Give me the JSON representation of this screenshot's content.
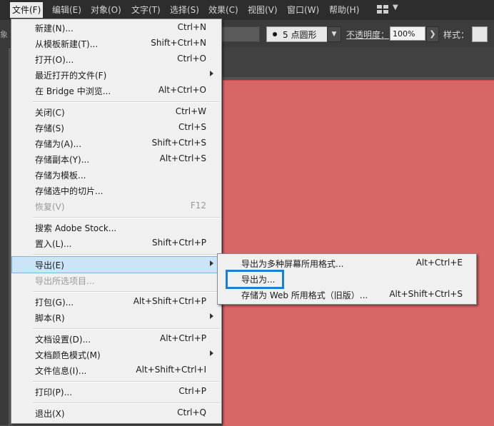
{
  "menubar": {
    "items": [
      "文件(F)",
      "编辑(E)",
      "对象(O)",
      "文字(T)",
      "选择(S)",
      "效果(C)",
      "视图(V)",
      "窗口(W)",
      "帮助(H)"
    ]
  },
  "controlbar": {
    "left_glyph": "象",
    "brush_label": "5 点圆形",
    "opacity_label": "不透明度：",
    "opacity_value": "100%",
    "style_label": "样式："
  },
  "file_menu": {
    "items": [
      {
        "label": "新建(N)...",
        "shortcut": "Ctrl+N"
      },
      {
        "label": "从模板新建(T)...",
        "shortcut": "Shift+Ctrl+N"
      },
      {
        "label": "打开(O)...",
        "shortcut": "Ctrl+O"
      },
      {
        "label": "最近打开的文件(F)",
        "shortcut": ""
      },
      {
        "label": "在 Bridge 中浏览...",
        "shortcut": "Alt+Ctrl+O"
      },
      {
        "label": "关闭(C)",
        "shortcut": "Ctrl+W"
      },
      {
        "label": "存储(S)",
        "shortcut": "Ctrl+S"
      },
      {
        "label": "存储为(A)...",
        "shortcut": "Shift+Ctrl+S"
      },
      {
        "label": "存储副本(Y)...",
        "shortcut": "Alt+Ctrl+S"
      },
      {
        "label": "存储为模板...",
        "shortcut": ""
      },
      {
        "label": "存储选中的切片...",
        "shortcut": ""
      },
      {
        "label": "恢复(V)",
        "shortcut": "F12"
      },
      {
        "label": "搜索 Adobe Stock...",
        "shortcut": ""
      },
      {
        "label": "置入(L)...",
        "shortcut": "Shift+Ctrl+P"
      },
      {
        "label": "导出(E)",
        "shortcut": ""
      },
      {
        "label": "导出所选项目...",
        "shortcut": ""
      },
      {
        "label": "打包(G)...",
        "shortcut": "Alt+Shift+Ctrl+P"
      },
      {
        "label": "脚本(R)",
        "shortcut": ""
      },
      {
        "label": "文档设置(D)...",
        "shortcut": "Alt+Ctrl+P"
      },
      {
        "label": "文档颜色模式(M)",
        "shortcut": ""
      },
      {
        "label": "文件信息(I)...",
        "shortcut": "Alt+Shift+Ctrl+I"
      },
      {
        "label": "打印(P)...",
        "shortcut": "Ctrl+P"
      },
      {
        "label": "退出(X)",
        "shortcut": "Ctrl+Q"
      }
    ]
  },
  "export_submenu": {
    "items": [
      {
        "label": "导出为多种屏幕所用格式...",
        "shortcut": "Alt+Ctrl+E"
      },
      {
        "label": "导出为...",
        "shortcut": ""
      },
      {
        "label": "存储为 Web 所用格式（旧版）...",
        "shortcut": "Alt+Shift+Ctrl+S"
      }
    ]
  },
  "colors": {
    "menubar_bg": "#2d2d2d",
    "artboard": "#d96666",
    "highlight": "#cce4f7",
    "focus_box": "#1a7fd6"
  }
}
